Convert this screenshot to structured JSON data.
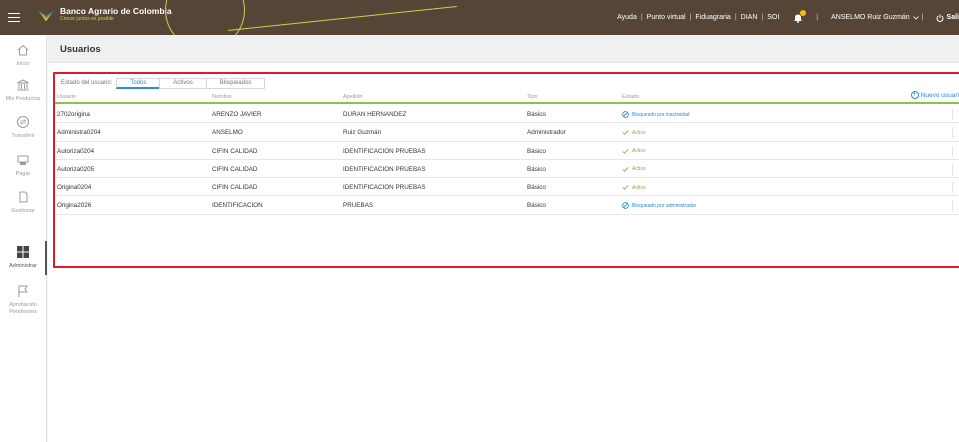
{
  "topbar": {
    "bank_name": "Banco Agrario de Colombia",
    "tagline": "Crecer juntos es posible",
    "links": [
      "Ayuda",
      "Punto virtual",
      "Fiduagraria",
      "DIAN",
      "SOI"
    ],
    "user_name": "ANSELMO Ruiz Guzmán",
    "exit_label": "Sali"
  },
  "sidebar": {
    "items": [
      {
        "label": "Inicio",
        "icon": "home-icon"
      },
      {
        "label": "Mis Productos",
        "icon": "bank-icon"
      },
      {
        "label": "Transferir",
        "icon": "transfer-icon"
      },
      {
        "label": "Pagar",
        "icon": "pay-icon"
      },
      {
        "label": "Gestionar",
        "icon": "manage-icon"
      },
      {
        "label": "Administrar",
        "icon": "grid-icon"
      },
      {
        "label": "Aprobación Pendientes",
        "icon": "flag-icon"
      }
    ]
  },
  "page": {
    "title": "Usuarios"
  },
  "filter": {
    "label": "Estado del usuario:",
    "tabs": [
      "Todos",
      "Activos",
      "Bloqueados"
    ],
    "active": "Todos"
  },
  "new_user_label": "Nuevo usuari",
  "table": {
    "headers": [
      "Usuario",
      "Nombre",
      "Apellido",
      "Tipo",
      "Estado"
    ],
    "rows": [
      {
        "user": "2702origina",
        "name": "ARENZO JAVIER",
        "last": "DURAN HERNANDEZ",
        "type": "Básico",
        "state": "Bloqueado por inactividad",
        "status": "blocked"
      },
      {
        "user": "Administra0204",
        "name": "ANSELMO",
        "last": "Ruiz Guzmán",
        "type": "Administrador",
        "state": "Activo",
        "status": "ok"
      },
      {
        "user": "Autoriza0204",
        "name": "CIFIN CALIDAD",
        "last": "IDENTIFICACION PRUEBAS",
        "type": "Básico",
        "state": "Activo",
        "status": "ok"
      },
      {
        "user": "Autoriza0205",
        "name": "CIFIN CALIDAD",
        "last": "IDENTIFICACION PRUEBAS",
        "type": "Básico",
        "state": "Activo",
        "status": "ok"
      },
      {
        "user": "Origina0204",
        "name": "CIFIN CALIDAD",
        "last": "IDENTIFICACION PRUEBAS",
        "type": "Básico",
        "state": "Activo",
        "status": "ok"
      },
      {
        "user": "Origina2026",
        "name": "IDENTIFICACION",
        "last": "PRUEBAS",
        "type": "Básico",
        "state": "Bloqueado por administrador",
        "status": "blocked"
      }
    ]
  },
  "colors": {
    "topbar": "#564536",
    "accent_green": "#8bc34a",
    "accent_blue": "#2e8bd4",
    "highlight_red": "#e01b24"
  }
}
